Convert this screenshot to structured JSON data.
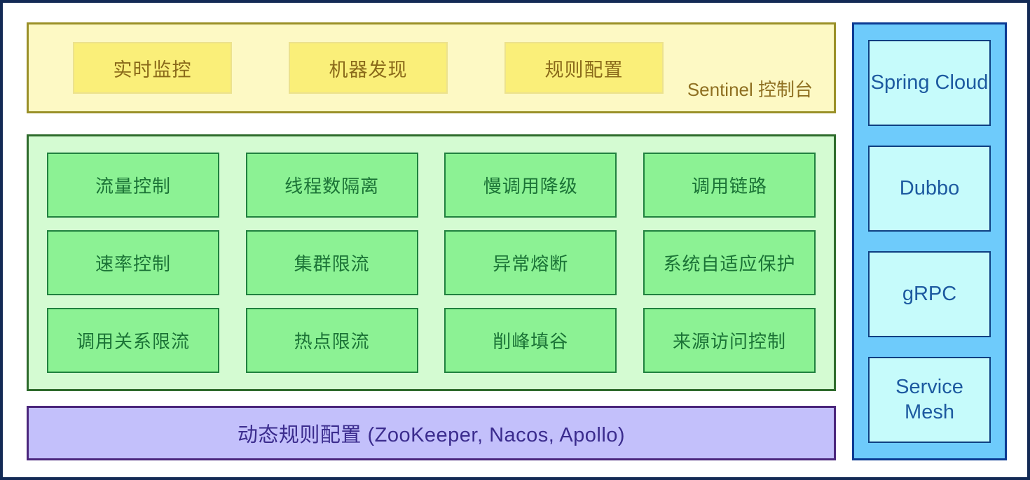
{
  "diagram": {
    "title": "Sentinel Architecture Overview",
    "frame_color": "#132a55",
    "background": "#ffffff"
  },
  "console": {
    "panel_name": "Sentinel Console",
    "label": "Sentinel 控制台",
    "panel_bg": "#fdf9c4",
    "panel_border": "#9a9028",
    "card_bg": "#faef79",
    "text_color": "#8a6a1a",
    "cards": [
      {
        "label": "实时监控"
      },
      {
        "label": "机器发现"
      },
      {
        "label": "规则配置"
      }
    ]
  },
  "core": {
    "panel_name": "Sentinel Core Features",
    "panel_bg": "#d4fbd2",
    "panel_border": "#2e6b2c",
    "card_bg": "#8cf294",
    "card_border": "#20813f",
    "text_color": "#1b7336",
    "rows": [
      {
        "cards": [
          {
            "label": "流量控制"
          },
          {
            "label": "线程数隔离"
          },
          {
            "label": "慢调用降级"
          },
          {
            "label": "调用链路"
          }
        ]
      },
      {
        "cards": [
          {
            "label": "速率控制"
          },
          {
            "label": "集群限流"
          },
          {
            "label": "异常熔断"
          },
          {
            "label": "系统自适应保护"
          }
        ]
      },
      {
        "cards": [
          {
            "label": "调用关系限流"
          },
          {
            "label": "热点限流"
          },
          {
            "label": "削峰填谷"
          },
          {
            "label": "来源访问控制"
          }
        ]
      }
    ]
  },
  "datasource": {
    "panel_name": "Dynamic Rule Configuration",
    "label": "动态规则配置 (ZooKeeper, Nacos, Apollo)",
    "panel_bg": "#c3c0fb",
    "panel_border": "#4b267c",
    "text_color": "#3b2c8e"
  },
  "adapters": {
    "panel_name": "Framework Adapters",
    "panel_bg": "#6ecbfb",
    "panel_border": "#0b3a93",
    "card_bg": "#c6fbfb",
    "card_border": "#0e3f82",
    "text_color": "#1d5aa0",
    "cards": [
      {
        "label": "Spring Cloud"
      },
      {
        "label": "Dubbo"
      },
      {
        "label": "gRPC"
      },
      {
        "label": "Service Mesh"
      }
    ]
  }
}
